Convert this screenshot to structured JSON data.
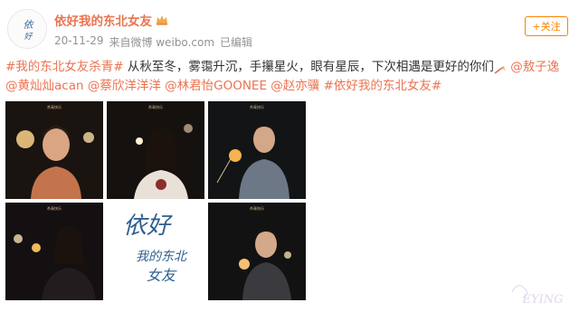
{
  "user": {
    "name": "依好我的东北女友",
    "badge_icon": "crown-icon",
    "time": "20-11-29",
    "source": "来自微博 weibo.com",
    "edited": "已编辑",
    "follow_label": "+关注"
  },
  "post": {
    "topic1": "#我的东北女友杀青#",
    "body": " 从秋至冬，雾霭升沉，手攥星火，眼有星辰，下次相遇是更好的你们",
    "flag_icon": "sparkler-emoji-icon",
    "mention1": " @敖子逸",
    "mention2": " @黄灿灿acan",
    "mention3": " @蔡欣洋洋洋",
    "mention4": " @林君怡GOONEE",
    "mention5": " @赵亦骥",
    "topic2": " #依好我的东北女友#"
  },
  "images": {
    "poster_title_line1": "依好",
    "poster_title_line2": "我的东北",
    "poster_title_line3": "女友",
    "still_caption": "杀青快乐"
  },
  "watermark": {
    "text": "EYING"
  },
  "colors": {
    "accent": "#eb7350",
    "follow": "#ff8200",
    "meta": "#939393"
  }
}
